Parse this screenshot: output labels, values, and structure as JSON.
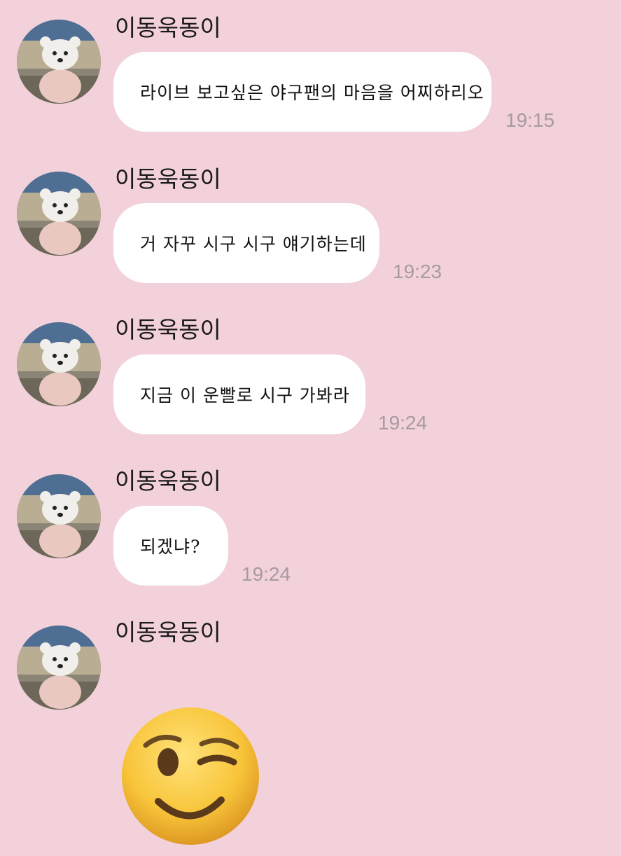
{
  "chat": {
    "messages": [
      {
        "sender": "이동욱동이",
        "text": "라이브 보고싶은 야구팬의 마음을 어찌하리오",
        "time": "19:15"
      },
      {
        "sender": "이동욱동이",
        "text": "거 자꾸 시구 시구 얘기하는데",
        "time": "19:23"
      },
      {
        "sender": "이동욱동이",
        "text": "지금 이 운빨로 시구 가봐라",
        "time": "19:24"
      },
      {
        "sender": "이동욱동이",
        "text": "되겠냐?",
        "time": "19:24"
      },
      {
        "sender": "이동욱동이",
        "emoji": "winking-face-emoji"
      }
    ]
  },
  "colors": {
    "background": "#f2d1da",
    "bubble": "#ffffff",
    "timestamp": "#a89ba0"
  }
}
